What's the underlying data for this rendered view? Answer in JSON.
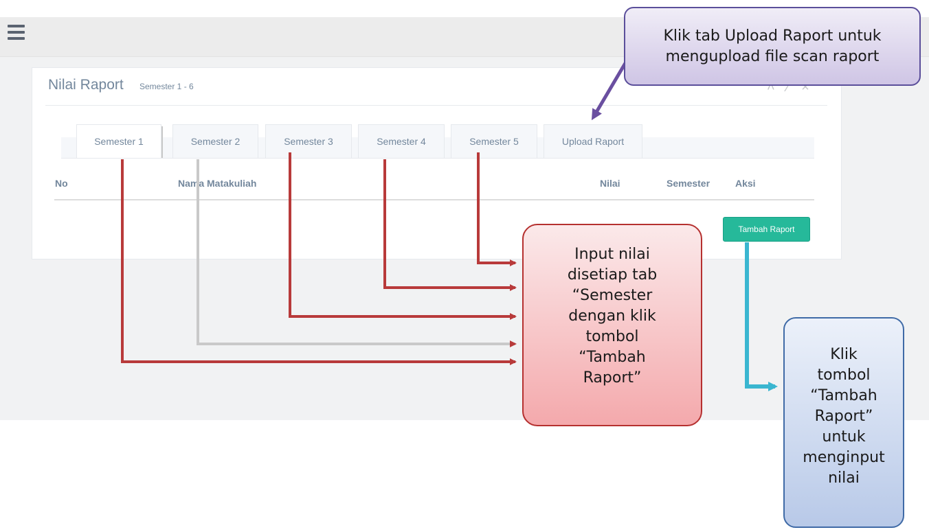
{
  "panel": {
    "title": "Nilai Raport",
    "subtitle": "Semester 1 - 6",
    "tools": "˄ ⁄ ×"
  },
  "tabs": [
    {
      "label": "Semester 1"
    },
    {
      "label": "Semester 2"
    },
    {
      "label": "Semester 3"
    },
    {
      "label": "Semester 4"
    },
    {
      "label": "Semester 5"
    },
    {
      "label": "Upload Raport"
    }
  ],
  "table": {
    "headers": {
      "no": "No",
      "nama": "Nama Matakuliah",
      "nilai": "Nilai",
      "semester": "Semester",
      "aksi": "Aksi"
    }
  },
  "buttons": {
    "tambah_raport": "Tambah Raport"
  },
  "callouts": {
    "upload": [
      "Klik tab Upload Raport untuk",
      "mengupload file scan raport"
    ],
    "input": [
      "Input nilai",
      "disetiap tab",
      "“Semester",
      "dengan klik",
      "tombol",
      "“Tambah",
      "Raport”"
    ],
    "tambah": [
      "Klik",
      "tombol",
      "“Tambah",
      "Raport”",
      "untuk",
      "menginput",
      "nilai"
    ]
  },
  "colors": {
    "accent_green": "#26b99a",
    "arrow_red": "#b83a3a",
    "arrow_blue": "#3ab6d0",
    "arrow_purple": "#6a4fa0"
  },
  "icons": {
    "menu": "hamburger-menu-icon"
  }
}
